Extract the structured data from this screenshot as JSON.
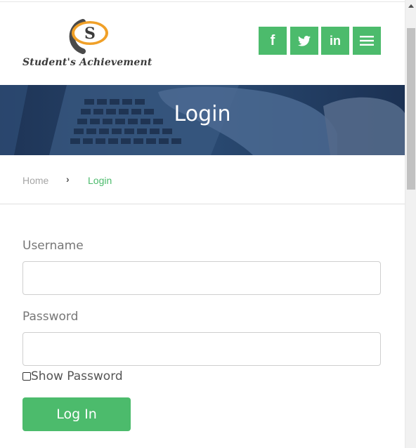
{
  "brand": {
    "logo_letter": "S",
    "name": "Student's Achievement"
  },
  "social": {
    "facebook": "f",
    "twitter": "twitter-icon",
    "linkedin": "in",
    "menu": "menu-icon"
  },
  "banner": {
    "title": "Login"
  },
  "breadcrumb": {
    "home": "Home",
    "separator": "›",
    "current": "Login"
  },
  "form": {
    "username_label": "Username",
    "username_value": "",
    "password_label": "Password",
    "password_value": "",
    "show_password_label": "Show Password",
    "show_password_checked": false,
    "submit_label": "Log In"
  },
  "colors": {
    "accent": "#4cbb6c",
    "banner": "#223a5e",
    "logo_orange": "#f0a028",
    "logo_dark": "#4a4a4a"
  }
}
